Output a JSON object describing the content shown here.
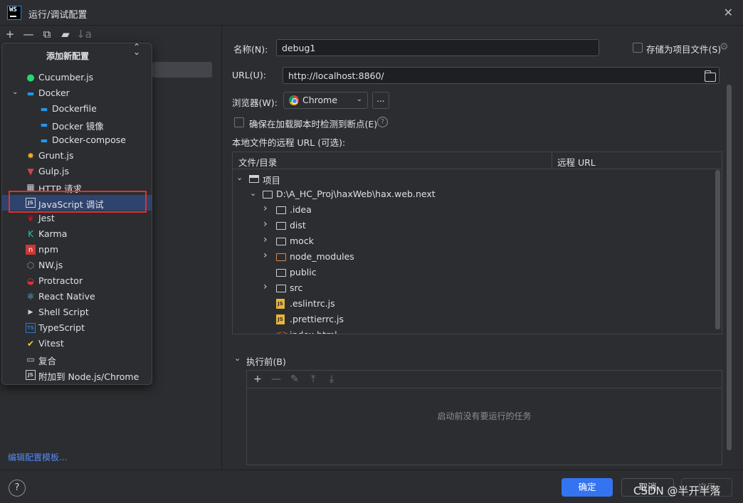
{
  "window": {
    "title": "运行/调试配置",
    "app_icon_text": "WS"
  },
  "toolbar": {
    "add": "+",
    "remove": "—",
    "copy": "⧉",
    "folder": "▰",
    "sort": "↓a"
  },
  "popup": {
    "title": "添加新配置",
    "items": [
      {
        "label": "Cucumber.js",
        "icon": "cucumber-icon",
        "level": 0
      },
      {
        "label": "Docker",
        "icon": "docker-icon",
        "level": 0,
        "expanded": true
      },
      {
        "label": "Dockerfile",
        "icon": "docker-icon",
        "level": 1
      },
      {
        "label": "Docker 镜像",
        "icon": "docker-icon",
        "level": 1
      },
      {
        "label": "Docker-compose",
        "icon": "docker-icon",
        "level": 1
      },
      {
        "label": "Grunt.js",
        "icon": "grunt-icon",
        "level": 0
      },
      {
        "label": "Gulp.js",
        "icon": "gulp-icon",
        "level": 0
      },
      {
        "label": "HTTP 请求",
        "icon": "http-icon",
        "level": 0
      },
      {
        "label": "JavaScript 调试",
        "icon": "js-debug-icon",
        "level": 0,
        "selected": true
      },
      {
        "label": "Jest",
        "icon": "jest-icon",
        "level": 0
      },
      {
        "label": "Karma",
        "icon": "karma-icon",
        "level": 0
      },
      {
        "label": "npm",
        "icon": "npm-icon",
        "level": 0
      },
      {
        "label": "NW.js",
        "icon": "nwjs-icon",
        "level": 0
      },
      {
        "label": "Protractor",
        "icon": "protractor-icon",
        "level": 0
      },
      {
        "label": "React Native",
        "icon": "react-icon",
        "level": 0
      },
      {
        "label": "Shell Script",
        "icon": "shell-icon",
        "level": 0
      },
      {
        "label": "TypeScript",
        "icon": "typescript-icon",
        "level": 0
      },
      {
        "label": "Vitest",
        "icon": "vitest-icon",
        "level": 0
      },
      {
        "label": "复合",
        "icon": "compound-icon",
        "level": 0
      },
      {
        "label": "附加到 Node.js/Chrome",
        "icon": "attach-node-icon",
        "level": 0
      }
    ]
  },
  "left": {
    "edit_templates": "编辑配置模板..."
  },
  "form": {
    "name_label": "名称(N):",
    "name_value": "debug1",
    "store_as_project_file": "存储为项目文件(S)",
    "url_label": "URL(U):",
    "url_value": "http://localhost:8860/",
    "browser_label": "浏览器(W):",
    "browser_value": "Chrome",
    "browser_more": "...",
    "ensure_breakpoints": "确保在加载脚本时检测到断点(E)",
    "remote_urls_label": "本地文件的远程 URL (可选):"
  },
  "table": {
    "col_file": "文件/目录",
    "col_remote": "远程 URL",
    "rows": [
      {
        "label": "项目",
        "type": "project",
        "indent": 0,
        "expandable": true,
        "expanded": true
      },
      {
        "label": "D:\\A_HC_Proj\\haxWeb\\hax.web.next",
        "type": "folder",
        "indent": 1,
        "expandable": true,
        "expanded": true
      },
      {
        "label": ".idea",
        "type": "folder",
        "indent": 2,
        "expandable": true
      },
      {
        "label": "dist",
        "type": "folder",
        "indent": 2,
        "expandable": true
      },
      {
        "label": "mock",
        "type": "folder",
        "indent": 2,
        "expandable": true
      },
      {
        "label": "node_modules",
        "type": "folder-orange",
        "indent": 2,
        "expandable": true
      },
      {
        "label": "public",
        "type": "folder",
        "indent": 2,
        "expandable": false
      },
      {
        "label": "src",
        "type": "folder",
        "indent": 2,
        "expandable": true
      },
      {
        "label": ".eslintrc.js",
        "type": "js",
        "indent": 2,
        "expandable": false
      },
      {
        "label": ".prettierrc.js",
        "type": "js",
        "indent": 2,
        "expandable": false
      },
      {
        "label": "index.html",
        "type": "html",
        "indent": 2,
        "expandable": false
      }
    ]
  },
  "before_launch": {
    "title": "执行前(B)",
    "empty_text": "启动前没有要运行的任务"
  },
  "footer": {
    "help": "?",
    "ok": "确定",
    "cancel": "取消",
    "apply": "应用"
  },
  "watermark": "CSDN @半开半落",
  "colors": {
    "accent": "#3574f0",
    "selection": "#2e436e",
    "highlight_box": "#e0312f",
    "link": "#548af7"
  }
}
